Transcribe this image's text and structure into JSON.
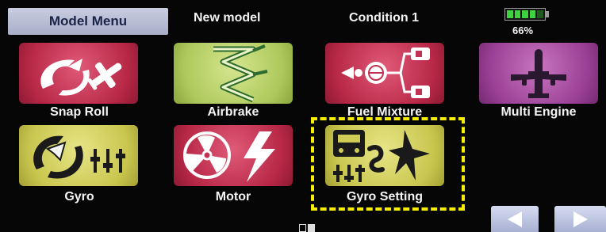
{
  "header": {
    "menu_tab": "Model Menu",
    "model_name": "New model",
    "condition": "Condition 1",
    "battery_percent": "66%",
    "battery_level": 0.66
  },
  "tiles": [
    {
      "label": "Snap Roll",
      "color": "#c13352",
      "icon": "snap-roll-plane-icon"
    },
    {
      "label": "Airbrake",
      "color": "#b6cf62",
      "icon": "airbrake-icon"
    },
    {
      "label": "Fuel Mixture",
      "color": "#c13352",
      "icon": "fuel-mixture-icon"
    },
    {
      "label": "Multi Engine",
      "color": "#9a3f95",
      "icon": "multi-engine-airplane-icon"
    },
    {
      "label": "Gyro",
      "color": "#cfcc56",
      "icon": "gyro-icon"
    },
    {
      "label": "Motor",
      "color": "#c13352",
      "icon": "motor-propeller-lightning-icon"
    },
    {
      "label": "Gyro Setting",
      "color": "#cfcc56",
      "icon": "gyro-setting-icon"
    }
  ],
  "highlight": {
    "target": "Gyro Setting",
    "color": "#f6ee00"
  },
  "nav": {
    "prev_icon": "left-arrow-icon",
    "next_icon": "right-arrow-icon"
  },
  "page_indicator": {
    "current": 2,
    "total": 2
  }
}
